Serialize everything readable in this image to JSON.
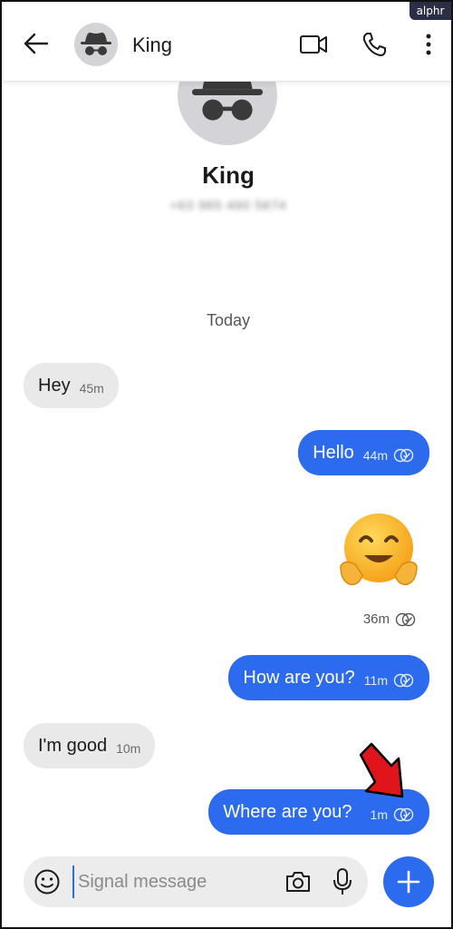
{
  "watermark": "alphr",
  "header": {
    "contact_name": "King",
    "icons": [
      "back-arrow-icon",
      "incognito-avatar-icon",
      "video-call-icon",
      "phone-icon",
      "more-vertical-icon"
    ]
  },
  "profile": {
    "name": "King",
    "phone": "+63 965 490 5674"
  },
  "conversation": {
    "date_separator": "Today",
    "messages": [
      {
        "direction": "incoming",
        "text": "Hey",
        "time": "45m"
      },
      {
        "direction": "outgoing",
        "text": "Hello",
        "time": "44m",
        "status": "read"
      },
      {
        "direction": "outgoing",
        "type": "emoji",
        "emoji": "🤗",
        "time": "36m",
        "status": "read"
      },
      {
        "direction": "outgoing",
        "text": "How are you?",
        "time": "11m",
        "status": "read"
      },
      {
        "direction": "incoming",
        "text": "I'm good",
        "time": "10m"
      },
      {
        "direction": "outgoing",
        "text": "Where are you?",
        "time": "1m",
        "status": "read"
      }
    ]
  },
  "composer": {
    "placeholder": "Signal message",
    "value": ""
  },
  "colors": {
    "accent": "#2c6bed",
    "incoming_bubble": "#e9e9e9",
    "annotation_arrow": "#e0141b"
  }
}
